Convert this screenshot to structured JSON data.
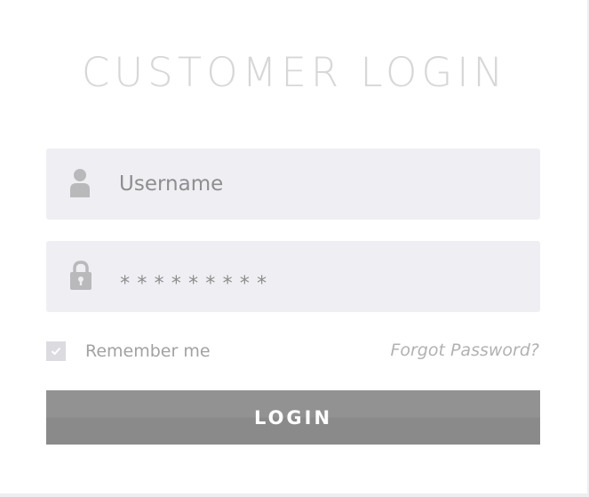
{
  "title": "CUSTOMER LOGIN",
  "username": {
    "placeholder": "Username",
    "value": "",
    "icon": "user-icon"
  },
  "password": {
    "value": "*********",
    "icon": "lock-icon"
  },
  "remember": {
    "label": "Remember me",
    "checked": true
  },
  "forgot_label": "Forgot Password?",
  "login_label": "LOGIN",
  "colors": {
    "field_bg": "#efeef3",
    "button_bg": "#8e8e8e",
    "title": "#d7d7d7",
    "icon": "#b9b9bc"
  }
}
